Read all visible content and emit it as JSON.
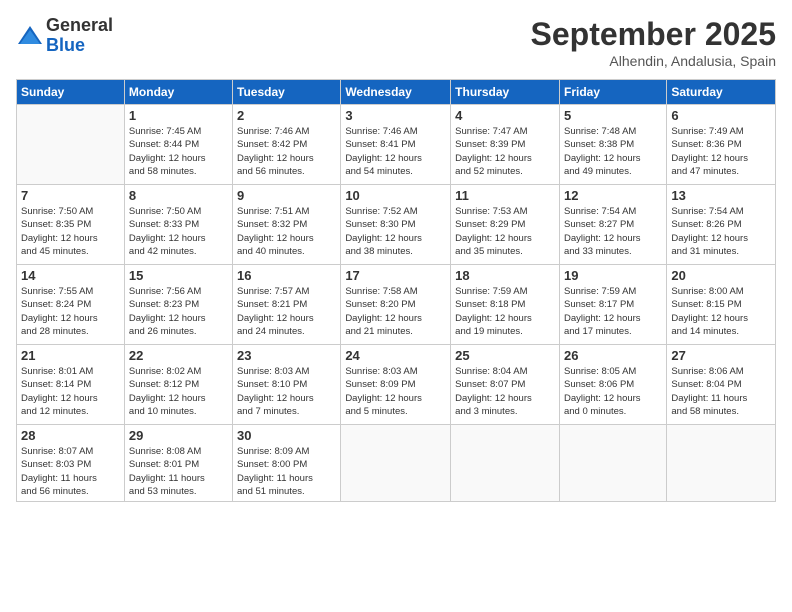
{
  "logo": {
    "general": "General",
    "blue": "Blue"
  },
  "header": {
    "month": "September 2025",
    "location": "Alhendin, Andalusia, Spain"
  },
  "days_of_week": [
    "Sunday",
    "Monday",
    "Tuesday",
    "Wednesday",
    "Thursday",
    "Friday",
    "Saturday"
  ],
  "weeks": [
    [
      {
        "day": "",
        "info": ""
      },
      {
        "day": "1",
        "info": "Sunrise: 7:45 AM\nSunset: 8:44 PM\nDaylight: 12 hours\nand 58 minutes."
      },
      {
        "day": "2",
        "info": "Sunrise: 7:46 AM\nSunset: 8:42 PM\nDaylight: 12 hours\nand 56 minutes."
      },
      {
        "day": "3",
        "info": "Sunrise: 7:46 AM\nSunset: 8:41 PM\nDaylight: 12 hours\nand 54 minutes."
      },
      {
        "day": "4",
        "info": "Sunrise: 7:47 AM\nSunset: 8:39 PM\nDaylight: 12 hours\nand 52 minutes."
      },
      {
        "day": "5",
        "info": "Sunrise: 7:48 AM\nSunset: 8:38 PM\nDaylight: 12 hours\nand 49 minutes."
      },
      {
        "day": "6",
        "info": "Sunrise: 7:49 AM\nSunset: 8:36 PM\nDaylight: 12 hours\nand 47 minutes."
      }
    ],
    [
      {
        "day": "7",
        "info": "Sunrise: 7:50 AM\nSunset: 8:35 PM\nDaylight: 12 hours\nand 45 minutes."
      },
      {
        "day": "8",
        "info": "Sunrise: 7:50 AM\nSunset: 8:33 PM\nDaylight: 12 hours\nand 42 minutes."
      },
      {
        "day": "9",
        "info": "Sunrise: 7:51 AM\nSunset: 8:32 PM\nDaylight: 12 hours\nand 40 minutes."
      },
      {
        "day": "10",
        "info": "Sunrise: 7:52 AM\nSunset: 8:30 PM\nDaylight: 12 hours\nand 38 minutes."
      },
      {
        "day": "11",
        "info": "Sunrise: 7:53 AM\nSunset: 8:29 PM\nDaylight: 12 hours\nand 35 minutes."
      },
      {
        "day": "12",
        "info": "Sunrise: 7:54 AM\nSunset: 8:27 PM\nDaylight: 12 hours\nand 33 minutes."
      },
      {
        "day": "13",
        "info": "Sunrise: 7:54 AM\nSunset: 8:26 PM\nDaylight: 12 hours\nand 31 minutes."
      }
    ],
    [
      {
        "day": "14",
        "info": "Sunrise: 7:55 AM\nSunset: 8:24 PM\nDaylight: 12 hours\nand 28 minutes."
      },
      {
        "day": "15",
        "info": "Sunrise: 7:56 AM\nSunset: 8:23 PM\nDaylight: 12 hours\nand 26 minutes."
      },
      {
        "day": "16",
        "info": "Sunrise: 7:57 AM\nSunset: 8:21 PM\nDaylight: 12 hours\nand 24 minutes."
      },
      {
        "day": "17",
        "info": "Sunrise: 7:58 AM\nSunset: 8:20 PM\nDaylight: 12 hours\nand 21 minutes."
      },
      {
        "day": "18",
        "info": "Sunrise: 7:59 AM\nSunset: 8:18 PM\nDaylight: 12 hours\nand 19 minutes."
      },
      {
        "day": "19",
        "info": "Sunrise: 7:59 AM\nSunset: 8:17 PM\nDaylight: 12 hours\nand 17 minutes."
      },
      {
        "day": "20",
        "info": "Sunrise: 8:00 AM\nSunset: 8:15 PM\nDaylight: 12 hours\nand 14 minutes."
      }
    ],
    [
      {
        "day": "21",
        "info": "Sunrise: 8:01 AM\nSunset: 8:14 PM\nDaylight: 12 hours\nand 12 minutes."
      },
      {
        "day": "22",
        "info": "Sunrise: 8:02 AM\nSunset: 8:12 PM\nDaylight: 12 hours\nand 10 minutes."
      },
      {
        "day": "23",
        "info": "Sunrise: 8:03 AM\nSunset: 8:10 PM\nDaylight: 12 hours\nand 7 minutes."
      },
      {
        "day": "24",
        "info": "Sunrise: 8:03 AM\nSunset: 8:09 PM\nDaylight: 12 hours\nand 5 minutes."
      },
      {
        "day": "25",
        "info": "Sunrise: 8:04 AM\nSunset: 8:07 PM\nDaylight: 12 hours\nand 3 minutes."
      },
      {
        "day": "26",
        "info": "Sunrise: 8:05 AM\nSunset: 8:06 PM\nDaylight: 12 hours\nand 0 minutes."
      },
      {
        "day": "27",
        "info": "Sunrise: 8:06 AM\nSunset: 8:04 PM\nDaylight: 11 hours\nand 58 minutes."
      }
    ],
    [
      {
        "day": "28",
        "info": "Sunrise: 8:07 AM\nSunset: 8:03 PM\nDaylight: 11 hours\nand 56 minutes."
      },
      {
        "day": "29",
        "info": "Sunrise: 8:08 AM\nSunset: 8:01 PM\nDaylight: 11 hours\nand 53 minutes."
      },
      {
        "day": "30",
        "info": "Sunrise: 8:09 AM\nSunset: 8:00 PM\nDaylight: 11 hours\nand 51 minutes."
      },
      {
        "day": "",
        "info": ""
      },
      {
        "day": "",
        "info": ""
      },
      {
        "day": "",
        "info": ""
      },
      {
        "day": "",
        "info": ""
      }
    ]
  ]
}
